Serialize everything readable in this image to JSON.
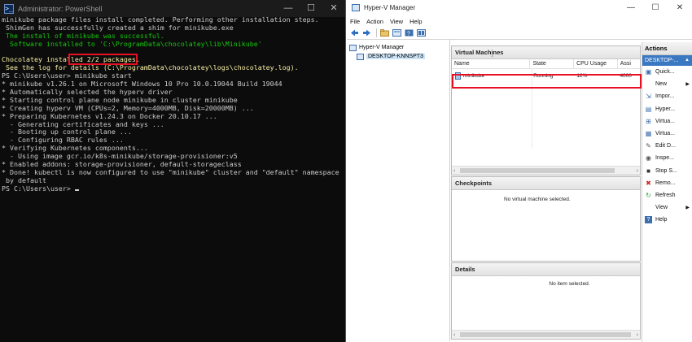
{
  "powershell": {
    "title": "Administrator: PowerShell",
    "icon_glyph": ">_",
    "controls": {
      "minimize": "—",
      "maximize": "☐",
      "close": "✕"
    },
    "lines": [
      {
        "text": "minikube package files install completed. Performing other installation steps.",
        "color": "default"
      },
      {
        "text": " ShimGen has successfully created a shim for minikube.exe",
        "color": "default"
      },
      {
        "text": " The install of minikube was successful.",
        "color": "green"
      },
      {
        "text": "  Software installed to 'C:\\ProgramData\\chocolatey\\lib\\Minikube'",
        "color": "green"
      },
      {
        "text": "",
        "color": "default"
      },
      {
        "text": "Chocolatey installed 2/2 packages.",
        "color": "yellow"
      },
      {
        "text": " See the log for details (C:\\ProgramData\\chocolatey\\logs\\chocolatey.log).",
        "color": "yellow"
      },
      {
        "text": "PS C:\\Users\\user> minikube start",
        "color": "default"
      },
      {
        "text": "* minikube v1.26.1 on Microsoft Windows 10 Pro 10.0.19044 Build 19044",
        "color": "default"
      },
      {
        "text": "* Automatically selected the hyperv driver",
        "color": "default"
      },
      {
        "text": "* Starting control plane node minikube in cluster minikube",
        "color": "default"
      },
      {
        "text": "* Creating hyperv VM (CPUs=2, Memory=4000MB, Disk=20000MB) ...",
        "color": "default"
      },
      {
        "text": "* Preparing Kubernetes v1.24.3 on Docker 20.10.17 ...",
        "color": "default"
      },
      {
        "text": "  - Generating certificates and keys ...",
        "color": "default"
      },
      {
        "text": "  - Booting up control plane ...",
        "color": "default"
      },
      {
        "text": "  - Configuring RBAC rules ...",
        "color": "default"
      },
      {
        "text": "* Verifying Kubernetes components...",
        "color": "default"
      },
      {
        "text": "  - Using image gcr.io/k8s-minikube/storage-provisioner:v5",
        "color": "default"
      },
      {
        "text": "* Enabled addons: storage-provisioner, default-storageclass",
        "color": "default"
      },
      {
        "text": "* Done! kubectl is now configured to use \"minikube\" cluster and \"default\" namespace",
        "color": "default"
      },
      {
        "text": " by default",
        "color": "default"
      },
      {
        "text": "PS C:\\Users\\user> ",
        "color": "default",
        "cursor": true
      }
    ],
    "colors": {
      "background": "#0c0c0c",
      "text": "#cccccc",
      "green": "#16c60c",
      "yellow": "#f9f1a5",
      "highlight": "#e81123"
    }
  },
  "hyperv": {
    "title": "Hyper-V Manager",
    "controls": {
      "minimize": "—",
      "maximize": "☐",
      "close": "✕"
    },
    "menu": [
      "File",
      "Action",
      "View",
      "Help"
    ],
    "toolbar": [
      "back-icon",
      "forward-icon",
      "folder-up-icon",
      "console-icon",
      "help-icon",
      "console-icon-2"
    ],
    "tree": {
      "root": "Hyper-V Manager",
      "host": "DESKTOP-KNNSPT3"
    },
    "vm_panel": {
      "title": "Virtual Machines",
      "columns": [
        "Name",
        "State",
        "CPU Usage",
        "Assi"
      ],
      "rows": [
        {
          "name": "minikube",
          "state": "Running",
          "cpu": "12%",
          "mem": "4000"
        }
      ]
    },
    "checkpoints": {
      "title": "Checkpoints",
      "empty": "No virtual machine selected."
    },
    "details": {
      "title": "Details",
      "empty": "No item selected."
    },
    "actions": {
      "title": "Actions",
      "host_label": "DESKTOP-...",
      "items": [
        {
          "label": "Quick...",
          "icon": "quick-create-icon",
          "submenu": false
        },
        {
          "label": "New",
          "icon": "",
          "submenu": true
        },
        {
          "label": "Impor...",
          "icon": "import-icon",
          "submenu": false
        },
        {
          "label": "Hyper...",
          "icon": "hyperv-settings-icon",
          "submenu": false
        },
        {
          "label": "Virtua...",
          "icon": "virtual-switch-icon",
          "submenu": false
        },
        {
          "label": "Virtua...",
          "icon": "virtual-san-icon",
          "submenu": false
        },
        {
          "label": "Edit D...",
          "icon": "edit-disk-icon",
          "submenu": false
        },
        {
          "label": "Inspe...",
          "icon": "inspect-disk-icon",
          "submenu": false
        },
        {
          "label": "Stop S...",
          "icon": "stop-service-icon",
          "submenu": false
        },
        {
          "label": "Remo...",
          "icon": "remove-server-icon",
          "submenu": false
        },
        {
          "label": "Refresh",
          "icon": "refresh-icon",
          "submenu": false
        },
        {
          "label": "View",
          "icon": "",
          "submenu": true
        },
        {
          "label": "Help",
          "icon": "help-icon",
          "submenu": false
        }
      ]
    },
    "colors": {
      "selection": "#3b78c2",
      "highlight": "#e81123"
    }
  }
}
